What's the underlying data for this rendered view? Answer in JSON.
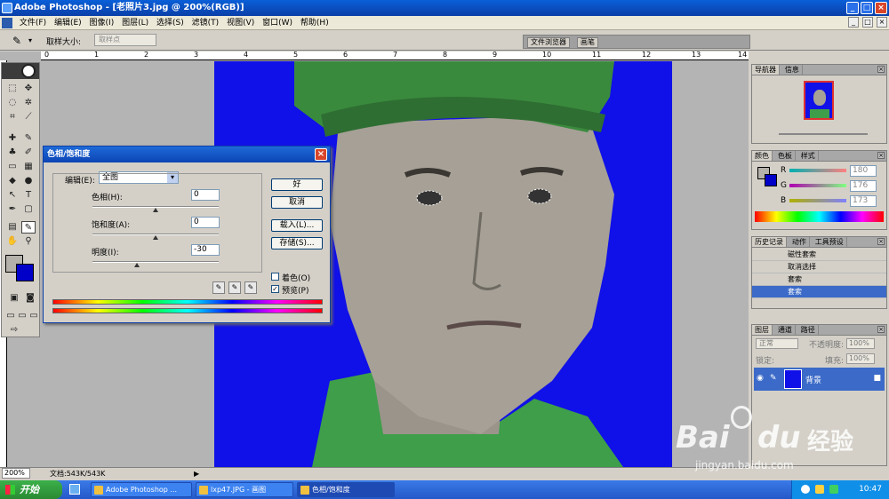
{
  "window": {
    "title": "Adobe Photoshop - [老照片3.jpg @ 200%(RGB)]"
  },
  "menu": [
    "文件(F)",
    "编辑(E)",
    "图像(I)",
    "图层(L)",
    "选择(S)",
    "滤镜(T)",
    "视图(V)",
    "窗口(W)",
    "帮助(H)"
  ],
  "options": {
    "sample_label": "取样大小:",
    "sample_value": "取样点",
    "well_tabs": [
      "文件浏览器",
      "画笔"
    ]
  },
  "ruler": [
    "0",
    "1",
    "2",
    "3",
    "4",
    "5",
    "6",
    "7",
    "8",
    "9",
    "10",
    "11",
    "12",
    "13",
    "14"
  ],
  "dialog": {
    "title": "色相/饱和度",
    "edit_label": "编辑(E):",
    "edit_value": "全图",
    "hue_label": "色相(H):",
    "hue_value": "0",
    "hue_pos": 0.5,
    "sat_label": "饱和度(A):",
    "sat_value": "0",
    "sat_pos": 0.5,
    "light_label": "明度(I):",
    "light_value": "-30",
    "light_pos": 0.35,
    "ok": "好",
    "cancel": "取消",
    "load": "载入(L)...",
    "save": "存储(S)...",
    "colorize": "着色(O)",
    "preview": "预览(P)"
  },
  "navigator": {
    "tabs": [
      "导航器",
      "信息"
    ]
  },
  "color_panel": {
    "tabs": [
      "颜色",
      "色板",
      "样式"
    ],
    "r_label": "R",
    "g_label": "G",
    "b_label": "B",
    "r": "180",
    "g": "176",
    "b": "173"
  },
  "history": {
    "tabs": [
      "历史记录",
      "动作",
      "工具预设"
    ],
    "items": [
      "磁性套索",
      "取消选择",
      "套索",
      "套索"
    ]
  },
  "layers": {
    "tabs": [
      "图层",
      "通道",
      "路径"
    ],
    "mode": "正常",
    "opacity_label": "不透明度:",
    "opacity": "100%",
    "lock_label": "锁定:",
    "fill_label": "填充:",
    "fill": "100%",
    "layer_name": "背景"
  },
  "status": {
    "zoom": "200%",
    "doc": "文档:543K/543K"
  },
  "taskbar": {
    "start": "开始",
    "tasks": [
      "Adobe Photoshop ...",
      "lxp47.JPG - 画图",
      "色相/饱和度"
    ],
    "time": "10:47"
  },
  "watermark": {
    "brand": "Bai",
    "brand2": "du",
    "cn": "经验",
    "url": "jingyan.baidu.com"
  },
  "colors": {
    "bg_blue": "#1010e8",
    "titlebar": "#0a4fc8",
    "selection": "#3b6ac8"
  }
}
